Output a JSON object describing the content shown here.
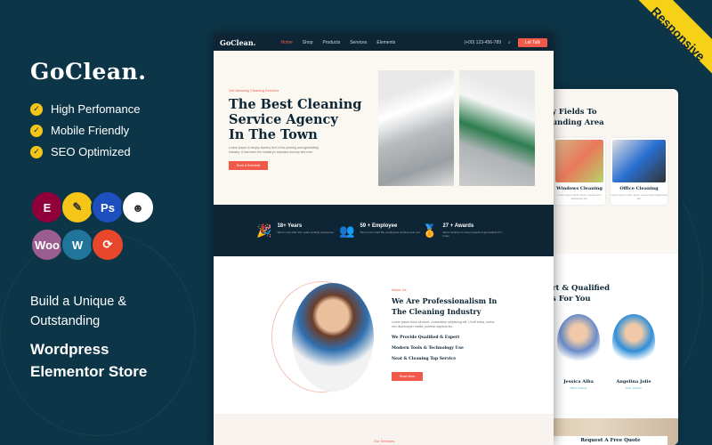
{
  "promo": {
    "brand": "GoClean.",
    "features": [
      "High Perfomance",
      "Mobile Friendly",
      "SEO Optimized"
    ],
    "tagline": [
      "Build a Unique &",
      "Outstanding"
    ],
    "product": [
      "Wordpress",
      "Elementor Store"
    ],
    "ribbon": "Responsive",
    "logos": [
      {
        "name": "elementor-icon",
        "glyph": "E",
        "color": "#92003b"
      },
      {
        "name": "notes-icon",
        "glyph": "✎",
        "color": "#f5c518"
      },
      {
        "name": "photoshop-icon",
        "glyph": "Ps",
        "color": "#1d4fbf"
      },
      {
        "name": "mailchimp-icon",
        "glyph": "☻",
        "color": "#ffffff"
      },
      {
        "name": "woocommerce-icon",
        "glyph": "Woo",
        "color": "#9b5c8f"
      },
      {
        "name": "wordpress-icon",
        "glyph": "W",
        "color": "#21759b"
      },
      {
        "name": "refresh-icon",
        "glyph": "⟳",
        "color": "#e8472b"
      }
    ]
  },
  "site": {
    "logo": "GoClean.",
    "nav": [
      "Home",
      "Shop",
      "Products",
      "Services",
      "Elements"
    ],
    "phone": "(+00) 123-456-789",
    "cta": "Let Talk",
    "hero": {
      "eyebrow": "Get Amazing Cleaning Services",
      "title": [
        "The Best Cleaning",
        "Service Agency",
        "In The Town"
      ],
      "text": "Lorem ipsum is simply dummy text of the printing and typesetting industry. It has been the industry's standard dummy text ever.",
      "button": "Book A Schedule"
    },
    "stats": [
      {
        "title": "18+ Years",
        "text": "We've more than 18+ years working experience.",
        "icon": "party-popper-icon"
      },
      {
        "title": "59 + Employee",
        "text": "We've more than 59+ employees working near you.",
        "icon": "people-icon"
      },
      {
        "title": "27 + Awards",
        "text": "We're working on many projects & get awards 27+ times.",
        "icon": "award-icon"
      }
    ],
    "about": {
      "eyebrow": "About Us",
      "title": [
        "We Are Professionalism In",
        "The Cleaning Industry"
      ],
      "text": "Lorem ipsum dolor sit amet, consectetur adipiscing elit. Ut elit tellus, luctus nec ullamcorper mattis, pulvinar dapibus leo.",
      "points": [
        "We Provide Qualified & Expert",
        "Modern Tools & Technology Use",
        "Neat & Cleaning Top Service"
      ],
      "button": "Read More"
    },
    "services_eyebrow": "Our Services"
  },
  "site2": {
    "fields_title": [
      "y Fields To",
      "unding Area"
    ],
    "cards": [
      {
        "title": "Windows Cleaning",
        "text": "Lorem ipsum dolor amet, consectetur adipiscing elit."
      },
      {
        "title": "Office Cleaning",
        "text": "Lorem ipsum dolor amet, consectetur adipiscing elit."
      }
    ],
    "team_title": [
      "rt & Qualified",
      "s For You"
    ],
    "team": [
      {
        "name": "Jessica Alba",
        "role": "Office Cleaner"
      },
      {
        "name": "Angelina Jolie",
        "role": "Team Cleaner"
      }
    ],
    "quote": "Request A Free Quote"
  }
}
